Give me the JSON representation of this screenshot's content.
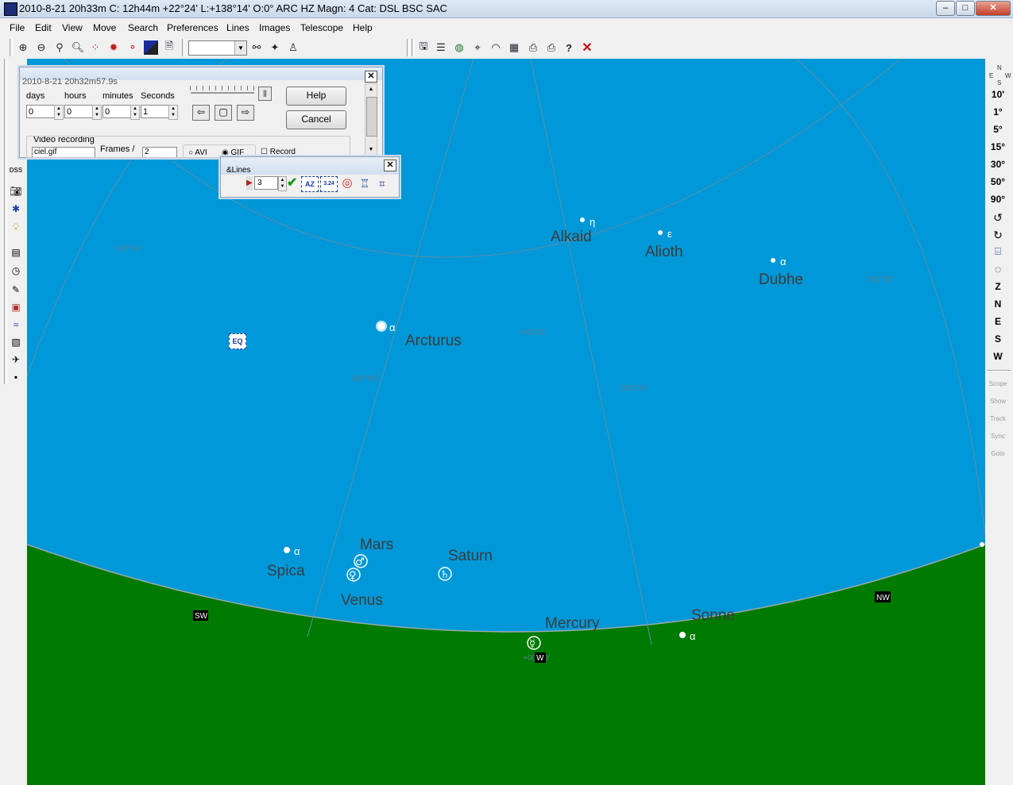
{
  "window": {
    "title": "2010-8-21  20h33m C: 12h44m +22°24' L:+138°14' O:0° ARC HZ  Magn: 4 Cat: DSL BSC SAC"
  },
  "menu": [
    "File",
    "Edit",
    "View",
    "Move",
    "Search",
    "Preferences",
    "Lines",
    "Images",
    "Telescope",
    "Help"
  ],
  "toolbar": {
    "fov_value": ""
  },
  "right_toolbar": {
    "fov_buttons": [
      "10'",
      "1°",
      "5°",
      "15°",
      "30°",
      "50°",
      "90°"
    ],
    "directions": [
      "Z",
      "N",
      "E",
      "S",
      "W"
    ],
    "scope_buttons": [
      "Scope",
      "Show",
      "Track",
      "Sync",
      "Goto"
    ],
    "orientation": [
      "N",
      "E",
      "W",
      "S"
    ]
  },
  "left_toolbar": {
    "dss_label": "DSS"
  },
  "animation_dialog": {
    "title": "2010-8-21  20h32m57.9s",
    "labels": {
      "days": "days",
      "hours": "hours",
      "minutes": "minutes",
      "seconds": "Seconds"
    },
    "values": {
      "days": "0",
      "hours": "0",
      "minutes": "0",
      "seconds": "1"
    },
    "help_label": "Help",
    "cancel_label": "Cancel",
    "pause_label": "||",
    "video_label": "Video recording",
    "file_value": "ciel.gif",
    "frames_label": "Frames /",
    "frames_value": "2",
    "avi_label": "AVI",
    "gif_label": "GIF",
    "record_label": "Record"
  },
  "lines_toolbar": {
    "title": "&Lines",
    "spin_value": "3",
    "eq_label": "EQ",
    "az_label": "AZ",
    "grid_label": "3.24"
  },
  "sky": {
    "colors": {
      "sky": "#0098d8",
      "ground": "#007a00",
      "grid": "#5f8fa8",
      "text": "#3c3c3c"
    },
    "grid_labels": [
      "195°00'",
      "+45°00'",
      "240°00'",
      "285°00'",
      "330°00'",
      "+00°00'"
    ],
    "compass": [
      "SW",
      "W",
      "NW"
    ],
    "stars": [
      {
        "name": "Alkaid",
        "greek": "η"
      },
      {
        "name": "Alioth",
        "greek": "ε"
      },
      {
        "name": "Dubhe",
        "greek": "α"
      },
      {
        "name": "Arcturus",
        "greek": "α"
      },
      {
        "name": "Spica",
        "greek": "α"
      },
      {
        "name": "Sonne",
        "greek": "α"
      }
    ],
    "planets": [
      {
        "name": "Mars",
        "symbol": "♂"
      },
      {
        "name": "Venus",
        "symbol": "♀"
      },
      {
        "name": "Saturn",
        "symbol": "♄"
      },
      {
        "name": "Mercury",
        "symbol": "☿"
      }
    ]
  }
}
